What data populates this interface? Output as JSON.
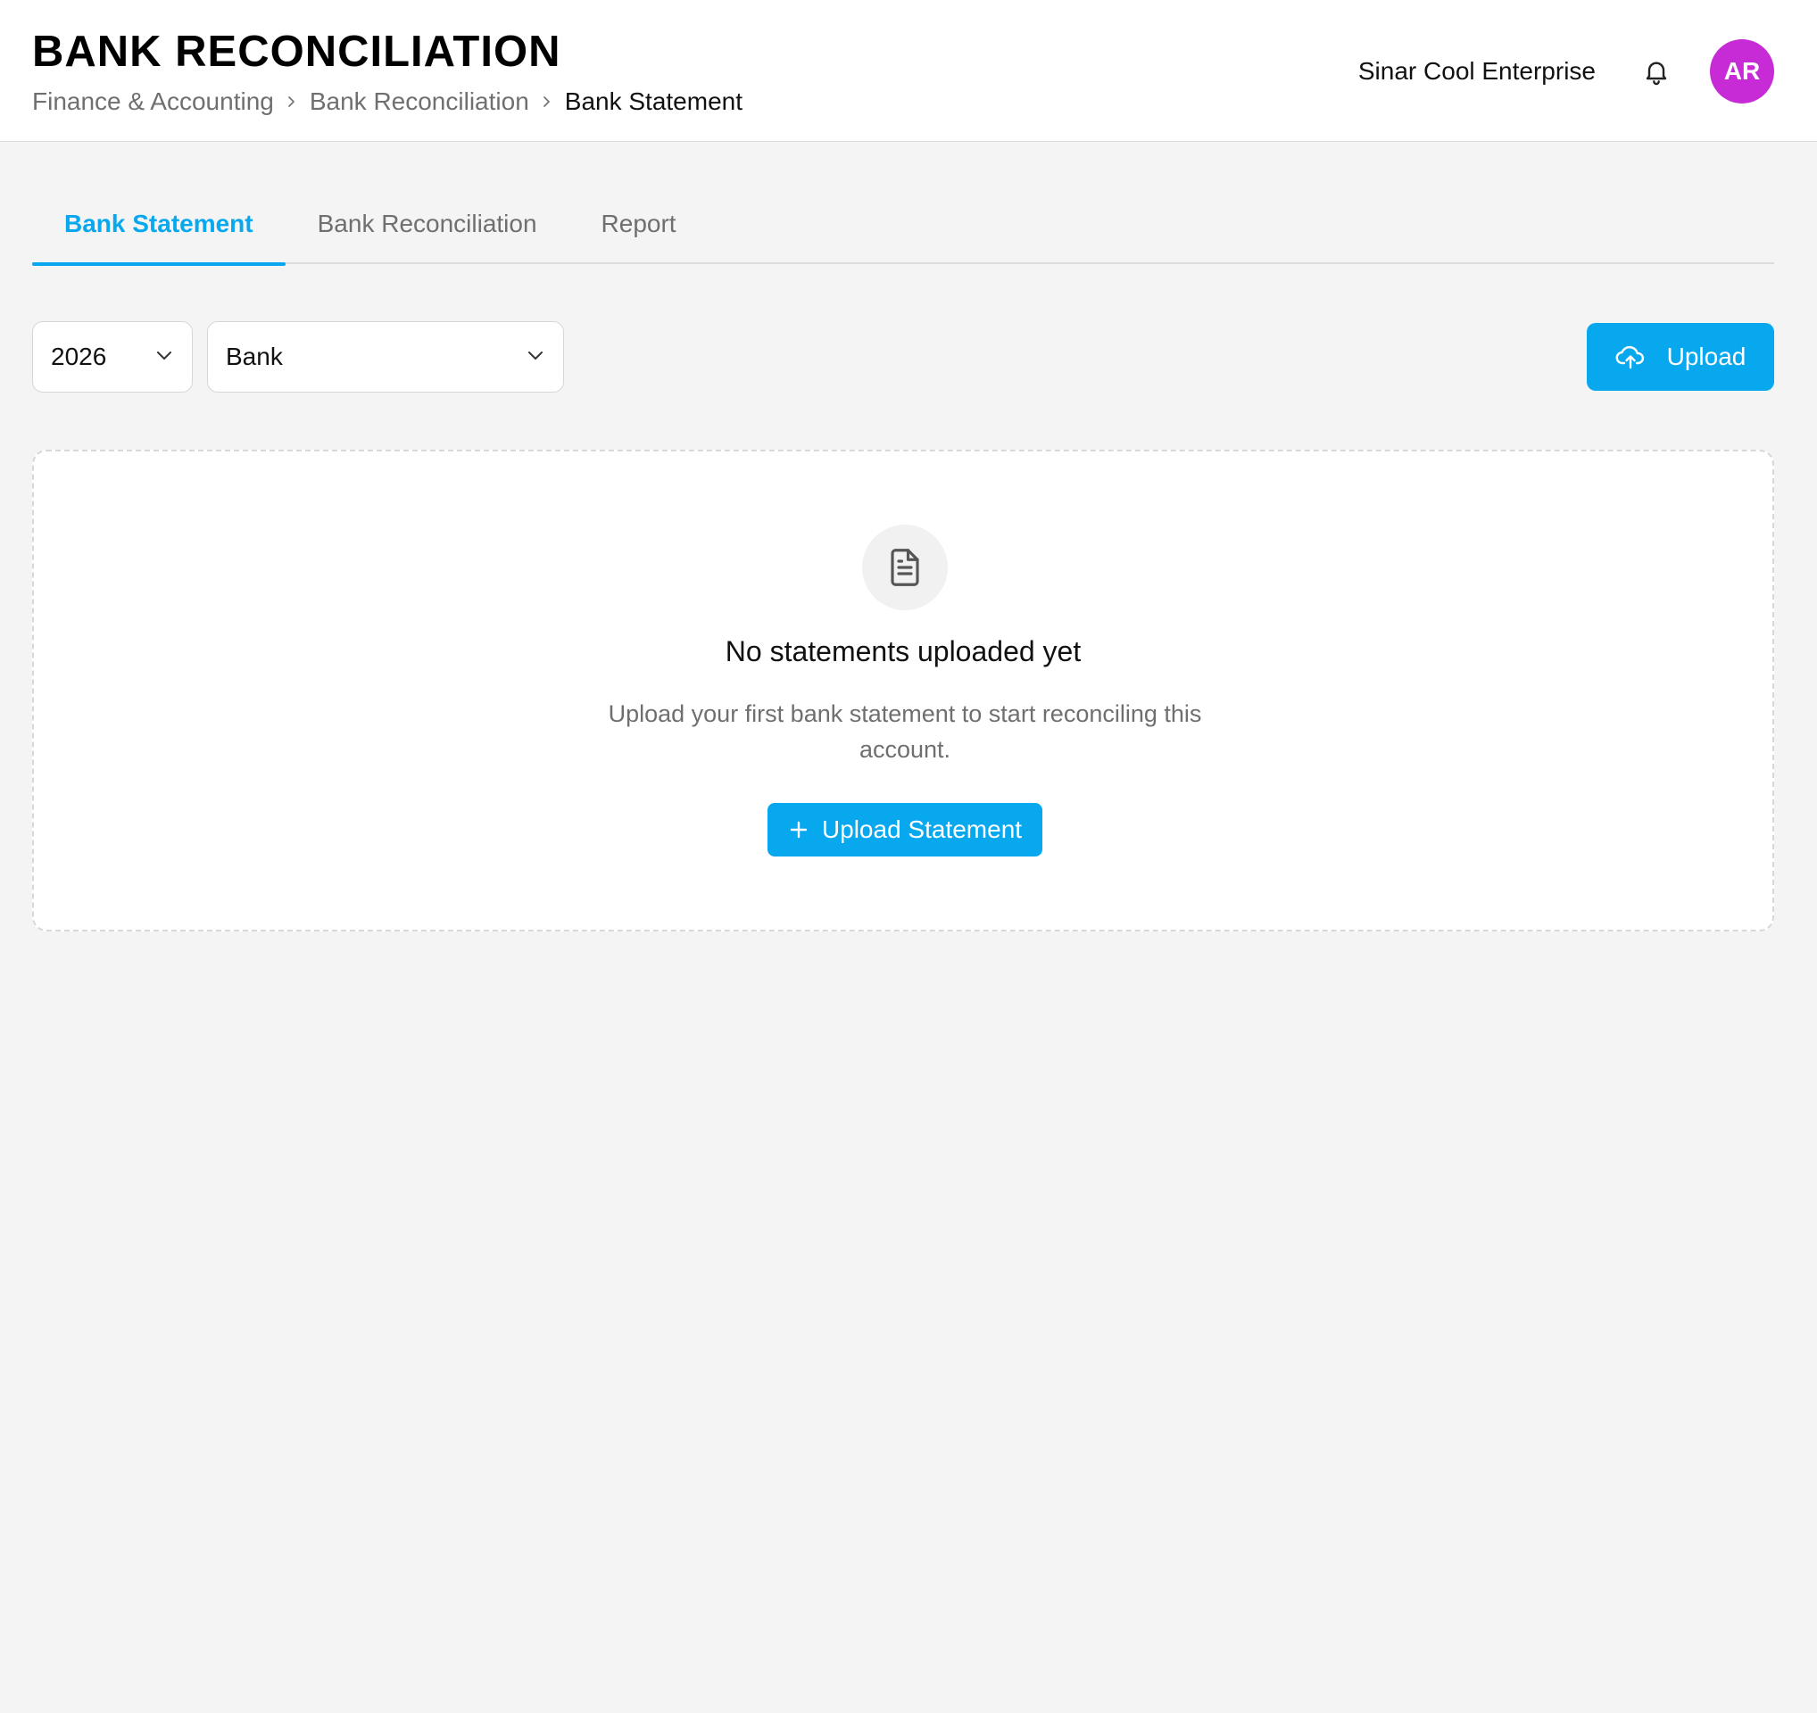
{
  "header": {
    "title": "BANK RECONCILIATION",
    "breadcrumb": [
      "Finance & Accounting",
      "Bank Reconciliation",
      "Bank Statement"
    ],
    "company": "Sinar Cool Enterprise",
    "avatar_initials": "AR",
    "avatar_color": "#c72bd6",
    "notification_icon": "bell-icon"
  },
  "tabs": [
    {
      "label": "Bank Statement",
      "active": true
    },
    {
      "label": "Bank Reconciliation",
      "active": false
    },
    {
      "label": "Report",
      "active": false
    }
  ],
  "filters": {
    "year": {
      "value": "2026"
    },
    "bank": {
      "value": "Bank"
    }
  },
  "toolbar": {
    "upload_label": "Upload",
    "upload_icon": "cloud-upload-icon"
  },
  "empty_state": {
    "icon": "document-icon",
    "title": "No statements uploaded yet",
    "description": "Upload your first bank statement to start reconciling this account.",
    "button_label": "Upload Statement",
    "button_icon": "plus-icon"
  },
  "colors": {
    "accent": "#08a8ef",
    "background": "#f4f4f4",
    "surface": "#ffffff",
    "muted_text": "#6f6f6f"
  }
}
